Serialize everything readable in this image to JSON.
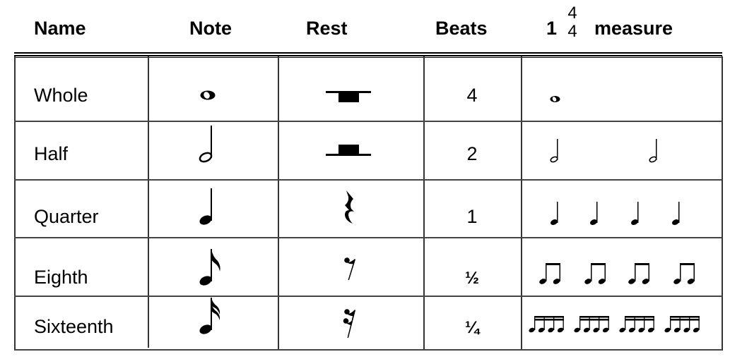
{
  "header": {
    "name": "Name",
    "note": "Note",
    "rest": "Rest",
    "beats": "Beats",
    "measure_prefix": "1",
    "time_signature_top": "4",
    "time_signature_bottom": "4",
    "measure_label": "measure"
  },
  "rows": [
    {
      "name": "Whole",
      "note_icon": "whole-note-icon",
      "rest_icon": "whole-rest-icon",
      "beats": "4",
      "measure_icons": [
        "whole-note-icon"
      ]
    },
    {
      "name": "Half",
      "note_icon": "half-note-icon",
      "rest_icon": "half-rest-icon",
      "beats": "2",
      "measure_icons": [
        "half-note-icon",
        "half-note-icon"
      ]
    },
    {
      "name": "Quarter",
      "note_icon": "quarter-note-icon",
      "rest_icon": "quarter-rest-icon",
      "beats": "1",
      "measure_icons": [
        "quarter-note-icon",
        "quarter-note-icon",
        "quarter-note-icon",
        "quarter-note-icon"
      ]
    },
    {
      "name": "Eighth",
      "note_icon": "eighth-note-icon",
      "rest_icon": "eighth-rest-icon",
      "beats": "½",
      "measure_icons": [
        "beamed-eighth-pair-icon",
        "beamed-eighth-pair-icon",
        "beamed-eighth-pair-icon",
        "beamed-eighth-pair-icon"
      ]
    },
    {
      "name": "Sixteenth",
      "note_icon": "sixteenth-note-icon",
      "rest_icon": "sixteenth-rest-icon",
      "beats": "¼",
      "measure_icons": [
        "beamed-sixteenth-group-icon",
        "beamed-sixteenth-group-icon",
        "beamed-sixteenth-group-icon",
        "beamed-sixteenth-group-icon"
      ]
    }
  ]
}
